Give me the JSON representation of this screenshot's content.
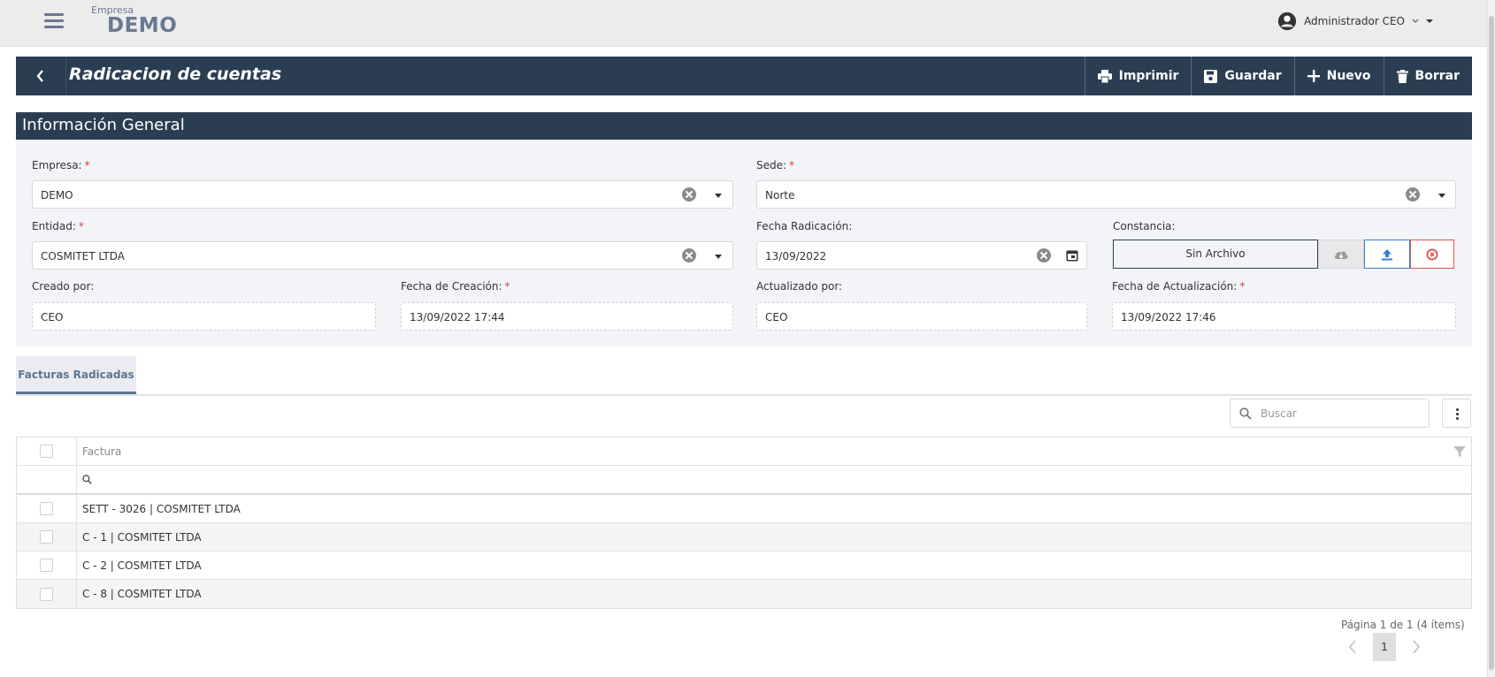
{
  "brand": {
    "subtitle": "Empresa",
    "name": "DEMO"
  },
  "user": {
    "name": "Administrador CEO"
  },
  "page": {
    "title": "Radicacion de cuentas"
  },
  "actions": {
    "print": "Imprimir",
    "save": "Guardar",
    "new": "Nuevo",
    "delete": "Borrar"
  },
  "section": {
    "title": "Información General"
  },
  "form": {
    "empresa": {
      "label": "Empresa:",
      "value": "DEMO"
    },
    "sede": {
      "label": "Sede:",
      "value": "Norte"
    },
    "entidad": {
      "label": "Entidad:",
      "value": "COSMITET LTDA"
    },
    "fecha_radicacion": {
      "label": "Fecha Radicación:",
      "value": "13/09/2022"
    },
    "constancia": {
      "label": "Constancia:",
      "value": "Sin Archivo"
    },
    "creado_por": {
      "label": "Creado por:",
      "value": "CEO"
    },
    "fecha_creacion": {
      "label": "Fecha de Creación:",
      "value": "13/09/2022 17:44"
    },
    "actualizado_por": {
      "label": "Actualizado por:",
      "value": "CEO"
    },
    "fecha_actualizacion": {
      "label": "Fecha de Actualización:",
      "value": "13/09/2022 17:46"
    },
    "required_mark": "*"
  },
  "tabs": [
    {
      "label": "Facturas Radicadas"
    }
  ],
  "search": {
    "placeholder": "Buscar"
  },
  "grid": {
    "column": "Factura",
    "rows": [
      "SETT - 3026 | COSMITET LTDA",
      "C - 1 | COSMITET LTDA",
      "C - 2 | COSMITET LTDA",
      "C - 8 | COSMITET LTDA"
    ]
  },
  "pager": {
    "info": "Página 1 de 1 (4 ítems)",
    "current": "1"
  },
  "colors": {
    "header_bg": "#2b3e51",
    "panel_bg": "#f3f4f8",
    "brand": "#6a7890",
    "upload": "#2f7ed8",
    "remove": "#e05555"
  },
  "icons": [
    "menu-icon",
    "user-avatar-icon",
    "chevron-down-icon",
    "back-arrow-icon",
    "printer-icon",
    "floppy-disk-icon",
    "plus-icon",
    "trash-icon",
    "clear-icon",
    "caret-down-icon",
    "calendar-icon",
    "cloud-download-icon",
    "upload-icon",
    "remove-circle-icon",
    "search-icon",
    "more-vertical-icon",
    "filter-icon",
    "chevron-left-icon",
    "chevron-right-icon"
  ]
}
